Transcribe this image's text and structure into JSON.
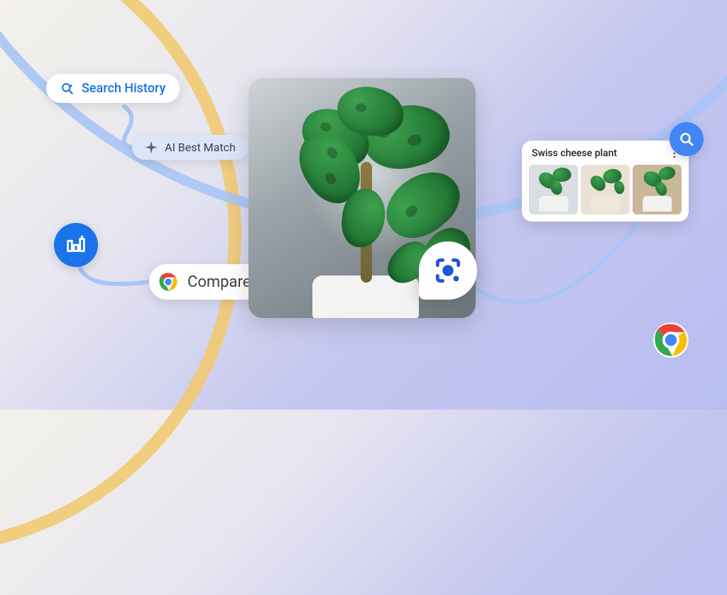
{
  "pills": {
    "search_history": "Search History",
    "ai_best_match": "AI Best Match",
    "compare": "Compare"
  },
  "results": {
    "title": "Swiss cheese plant"
  },
  "colors": {
    "blue": "#1a73e8",
    "fab_blue": "#4285f4"
  }
}
